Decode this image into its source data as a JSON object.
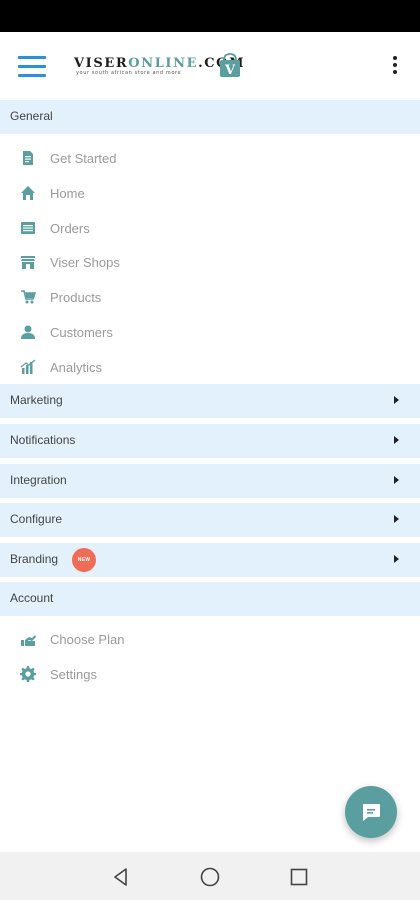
{
  "header": {
    "logo_text_dark": "VISER",
    "logo_text_accent": "ONLINE",
    "logo_text_suffix": ".COM",
    "logo_tagline": "your south african store and more",
    "bag_letter": "V",
    "brand_color": "#5a9ea0",
    "menu_icon_color": "#2a8fdc"
  },
  "sections": {
    "general": "General",
    "marketing": "Marketing",
    "notifications": "Notifications",
    "integration": "Integration",
    "configure": "Configure",
    "branding": "Branding",
    "branding_badge": "NEW",
    "account": "Account"
  },
  "general_items": [
    {
      "label": "Get Started",
      "icon": "document-icon"
    },
    {
      "label": "Home",
      "icon": "home-icon"
    },
    {
      "label": "Orders",
      "icon": "orders-icon"
    },
    {
      "label": "Viser Shops",
      "icon": "store-icon"
    },
    {
      "label": "Products",
      "icon": "products-icon"
    },
    {
      "label": "Customers",
      "icon": "customer-icon"
    },
    {
      "label": "Analytics",
      "icon": "analytics-icon"
    }
  ],
  "account_items": [
    {
      "label": "Choose Plan",
      "icon": "plan-icon"
    },
    {
      "label": "Settings",
      "icon": "gear-icon"
    }
  ],
  "colors": {
    "section_bg": "#e3f1fc",
    "item_icon": "#5a9ea0",
    "badge": "#f06c56"
  }
}
